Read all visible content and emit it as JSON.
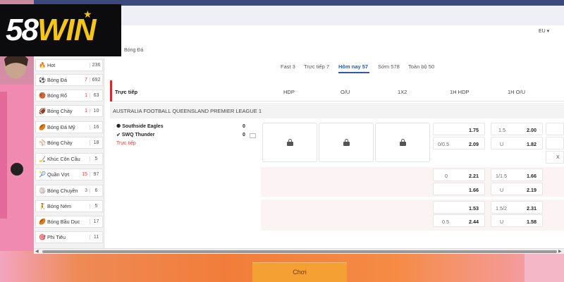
{
  "brand": {
    "logo_a": "58",
    "logo_b": "WIN",
    "star": "★",
    "accent": "#f5c518"
  },
  "region": "EU",
  "breadcrumb": "Bóng Đá",
  "tabs": [
    {
      "label": "Fast 3"
    },
    {
      "label": "Trực tiếp 7"
    },
    {
      "label": "Hôm nay 57"
    },
    {
      "label": "Sớm 578"
    },
    {
      "label": "Toàn bộ 50"
    }
  ],
  "sidebar": {
    "items": [
      {
        "icon": "🔥",
        "label": "Hot",
        "live": "",
        "count": "236"
      },
      {
        "icon": "⚽",
        "label": "Bóng Đá",
        "live": "7",
        "count": "692"
      },
      {
        "icon": "🏀",
        "label": "Bóng Rổ",
        "live": "1",
        "count": "63"
      },
      {
        "icon": "🏈",
        "label": "Bóng Chày",
        "live": "1",
        "count": "10"
      },
      {
        "icon": "🏉",
        "label": "Bóng Đá Mỹ",
        "live": "",
        "count": "16"
      },
      {
        "icon": "⚾",
        "label": "Bóng Chày",
        "live": "",
        "count": "18"
      },
      {
        "icon": "🏒",
        "label": "Khúc Côn Cầu",
        "live": "",
        "count": "5"
      },
      {
        "icon": "🎾",
        "label": "Quần Vợt",
        "live": "15",
        "count": "97"
      },
      {
        "icon": "🏐",
        "label": "Bóng Chuyền",
        "live": "3",
        "count": "6"
      },
      {
        "icon": "🤾",
        "label": "Bóng Ném",
        "live": "",
        "count": "5"
      },
      {
        "icon": "🏉",
        "label": "Bóng Bầu Dục",
        "live": "",
        "count": "17"
      },
      {
        "icon": "🎯",
        "label": "Phi Tiêu",
        "live": "",
        "count": "11"
      }
    ]
  },
  "table": {
    "live_header": "Trực tiếp",
    "columns": [
      "HDP",
      "O/U",
      "1X2",
      "1H HDP",
      "1H O/U"
    ],
    "league": "AUSTRALIA FOOTBALL QUEENSLAND PREMIER LEAGUE 1",
    "match": {
      "home": "Southside Eagles",
      "away": "SWQ Thunder",
      "home_score": "0",
      "away_score": "0",
      "status": "Trực tiếp"
    },
    "hdp_odds": [
      {
        "h": "",
        "v": "1.75"
      },
      {
        "h": "0/0.5",
        "v": "2.09"
      },
      {
        "h": "0",
        "v": "2.21"
      },
      {
        "h": "",
        "v": "1.66"
      },
      {
        "h": "",
        "v": "1.53"
      },
      {
        "h": "0.5",
        "v": "2.44"
      }
    ],
    "ou_odds": [
      {
        "h": "1.5",
        "v": "2.00"
      },
      {
        "h": "U",
        "v": "1.82"
      },
      {
        "h": "1/1.5",
        "v": "1.66"
      },
      {
        "h": "U",
        "v": "2.19"
      },
      {
        "h": "1.5/2",
        "v": "2.31"
      },
      {
        "h": "U",
        "v": "1.58"
      }
    ],
    "x_label": "X"
  },
  "play_button": "Chơi"
}
